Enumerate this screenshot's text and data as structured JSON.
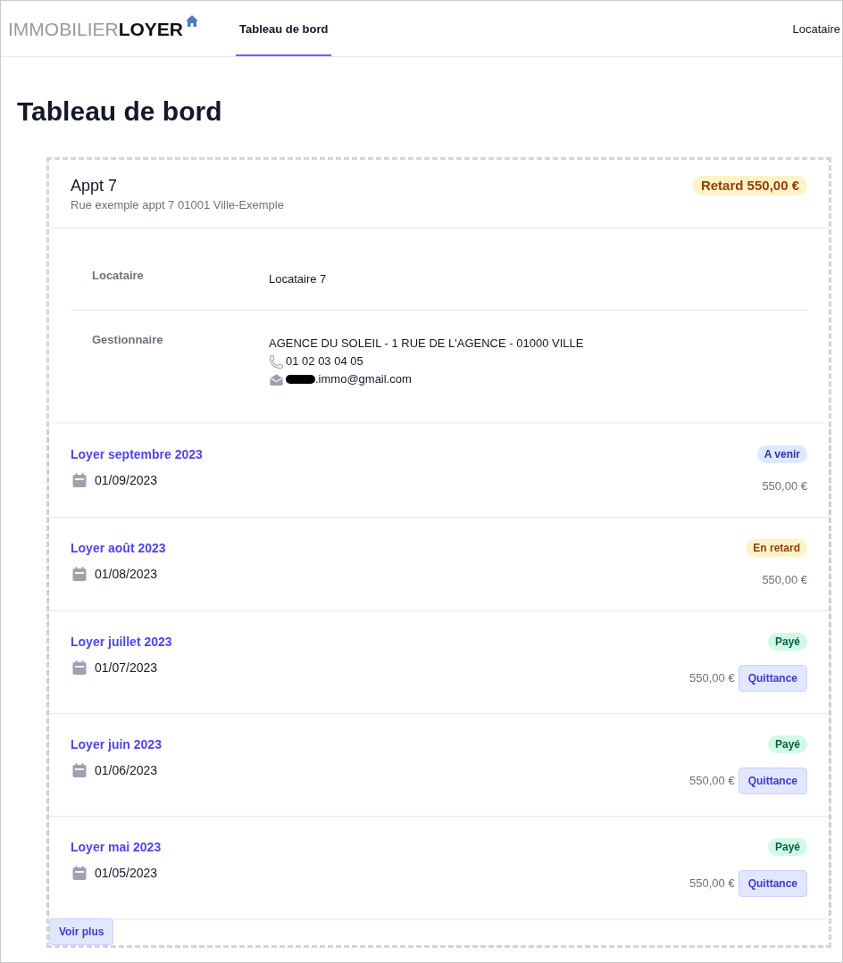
{
  "header": {
    "logo": {
      "light": "IMMOBILIER",
      "dark": "LOYER"
    },
    "nav": [
      {
        "label": "Tableau de bord",
        "selected": true
      }
    ],
    "user_menu": "Locataire"
  },
  "page_title": "Tableau de bord",
  "property": {
    "name": "Appt 7",
    "address": "Rue exemple appt 7 01001 Ville-Exemple",
    "balance_badge": {
      "label": "Retard 550,00 €",
      "kind": "late"
    },
    "details": [
      {
        "label": "Locataire",
        "lines": [
          {
            "kind": "text",
            "text": "Locataire 7"
          }
        ]
      },
      {
        "label": "Gestionnaire",
        "lines": [
          {
            "kind": "text",
            "text": "AGENCE DU SOLEIL - 1 RUE DE L'AGENCE - 01000 VILLE"
          },
          {
            "kind": "phone",
            "text": "01 02 03 04 05"
          },
          {
            "kind": "email",
            "text": ".immo@gmail.com",
            "redacted": true
          }
        ]
      }
    ]
  },
  "rents": [
    {
      "title": "Loyer septembre 2023",
      "date": "01/09/2023",
      "status": {
        "label": "A venir",
        "kind": "upcoming"
      },
      "amount": "550,00 €"
    },
    {
      "title": "Loyer août 2023",
      "date": "01/08/2023",
      "status": {
        "label": "En retard",
        "kind": "late"
      },
      "amount": "550,00 €"
    },
    {
      "title": "Loyer juillet 2023",
      "date": "01/07/2023",
      "status": {
        "label": "Payé",
        "kind": "paid"
      },
      "amount": "550,00 €",
      "action": "Quittance"
    },
    {
      "title": "Loyer juin 2023",
      "date": "01/06/2023",
      "status": {
        "label": "Payé",
        "kind": "paid"
      },
      "amount": "550,00 €",
      "action": "Quittance"
    },
    {
      "title": "Loyer mai 2023",
      "date": "01/05/2023",
      "status": {
        "label": "Payé",
        "kind": "paid"
      },
      "amount": "550,00 €",
      "action": "Quittance"
    }
  ],
  "more_button": "Voir plus"
}
